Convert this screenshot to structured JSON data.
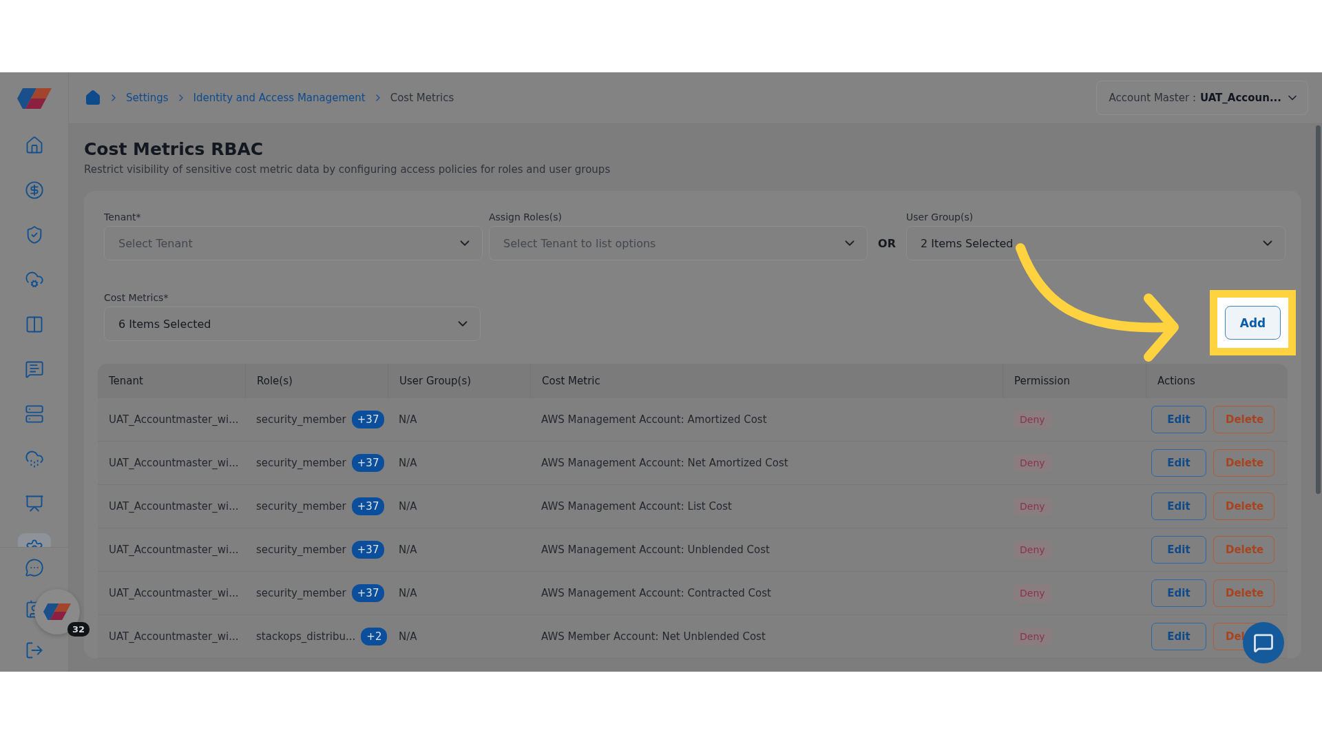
{
  "sidebar": {
    "items": [
      {
        "selected": false
      },
      {
        "selected": false
      },
      {
        "selected": false
      },
      {
        "selected": false
      },
      {
        "selected": false
      },
      {
        "selected": false
      },
      {
        "selected": false
      },
      {
        "selected": false
      },
      {
        "selected": false
      },
      {
        "selected": true
      }
    ],
    "bottom_items": [
      {
        "selected": false
      },
      {
        "selected": false
      },
      {
        "selected": false
      }
    ]
  },
  "breadcrumb": [
    {
      "label": "Settings",
      "current": false
    },
    {
      "label": "Identity and Access Management",
      "current": false
    },
    {
      "label": "Cost Metrics",
      "current": true
    }
  ],
  "account": {
    "label": "Account Master :",
    "value": "UAT_Accoun..."
  },
  "page": {
    "title": "Cost Metrics RBAC",
    "subtitle": "Restrict visibility of sensitive cost metric data by configuring access policies for roles and user groups"
  },
  "form": {
    "tenant": {
      "label": "Tenant*",
      "placeholder": "Select Tenant"
    },
    "roles": {
      "label": "Assign Roles(s)",
      "placeholder": "Select Tenant to list options"
    },
    "or_label": "OR",
    "user_groups": {
      "label": "User Group(s)",
      "value": "2 Items Selected"
    },
    "cost_metrics": {
      "label": "Cost Metrics*",
      "value": "6 Items Selected"
    },
    "add_button": "Add"
  },
  "table": {
    "columns": [
      "Tenant",
      "Role(s)",
      "User Group(s)",
      "Cost Metric",
      "Permission",
      "Actions"
    ],
    "rows": [
      {
        "tenant": "UAT_Accountmaster_wi...",
        "role": "security_member",
        "more_roles": "+37",
        "user_group": "N/A",
        "cost_metric": "AWS Management Account: Amortized Cost",
        "permission": "Deny",
        "edit": "Edit",
        "delete": "Delete"
      },
      {
        "tenant": "UAT_Accountmaster_wi...",
        "role": "security_member",
        "more_roles": "+37",
        "user_group": "N/A",
        "cost_metric": "AWS Management Account: Net Amortized Cost",
        "permission": "Deny",
        "edit": "Edit",
        "delete": "Delete"
      },
      {
        "tenant": "UAT_Accountmaster_wi...",
        "role": "security_member",
        "more_roles": "+37",
        "user_group": "N/A",
        "cost_metric": "AWS Management Account: List Cost",
        "permission": "Deny",
        "edit": "Edit",
        "delete": "Delete"
      },
      {
        "tenant": "UAT_Accountmaster_wi...",
        "role": "security_member",
        "more_roles": "+37",
        "user_group": "N/A",
        "cost_metric": "AWS Management Account: Unblended Cost",
        "permission": "Deny",
        "edit": "Edit",
        "delete": "Delete"
      },
      {
        "tenant": "UAT_Accountmaster_wi...",
        "role": "security_member",
        "more_roles": "+37",
        "user_group": "N/A",
        "cost_metric": "AWS Management Account: Contracted Cost",
        "permission": "Deny",
        "edit": "Edit",
        "delete": "Delete"
      },
      {
        "tenant": "UAT_Accountmaster_wi...",
        "role": "stackops_distribu...",
        "more_roles": "+2",
        "user_group": "N/A",
        "cost_metric": "AWS Member Account: Net Unblended Cost",
        "permission": "Deny",
        "edit": "Edit",
        "delete": "Del"
      }
    ]
  },
  "floating_badge": {
    "count": "32"
  }
}
